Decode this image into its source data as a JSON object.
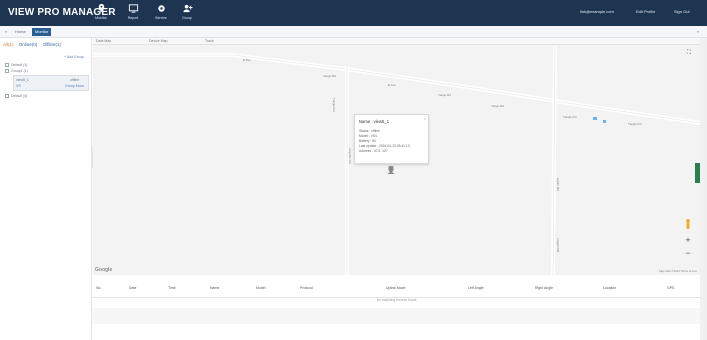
{
  "app": {
    "title": "VIEW PRO MANAGER"
  },
  "nav": [
    {
      "label": "Monitor",
      "icon": "location-pin-icon"
    },
    {
      "label": "Report",
      "icon": "monitor-icon"
    },
    {
      "label": "Service",
      "icon": "gear-icon"
    },
    {
      "label": "Group",
      "icon": "user-add-icon"
    }
  ],
  "topright": {
    "email": "link@example.com",
    "profile": "Edit Profile",
    "signout": "Sign Out"
  },
  "tabs": [
    {
      "label": "Home"
    },
    {
      "label": "Monitor"
    }
  ],
  "sidebar": {
    "filters": [
      "All(1)",
      "Online(0)",
      "Offline(1)"
    ],
    "add_group": "+ Add Group",
    "tree": [
      {
        "label": "Default (1)"
      },
      {
        "label": "Group1 (1)"
      },
      {
        "label": "view5_1",
        "status": "offline"
      },
      {
        "label": "VS",
        "status": "Group Move"
      },
      {
        "label": "Default (0)"
      }
    ]
  },
  "map": {
    "toolbar": [
      "Data Map",
      "Device Map",
      "Track"
    ],
    "roads": [
      "E Ave",
      "Yanjie Rd",
      "E Ave",
      "Yanjie Rd",
      "Yanjie Rd",
      "Tianjie Rd",
      "Tianjie Rd",
      "Tianjie Rd",
      "Ling Shi Rd",
      "Hanfu Rd",
      "Lingshi Rd"
    ],
    "google": "Google",
    "attribution": "Map data ©2024  Terms of Use"
  },
  "popup": {
    "title": "Name : view5_1",
    "rows": [
      "Status : offline",
      "Model : VS4",
      "Battery : 80",
      "Last update : 2024-04-13 05:41:13",
      "Address : 37.5, 127"
    ]
  },
  "table": {
    "headers": [
      "No.",
      "Date",
      "Time",
      "Name",
      "Model",
      "Protocol",
      "Uplink Mode",
      "Left Angle",
      "Right Angle",
      "Location",
      "GPS"
    ],
    "empty": "No matching records found"
  }
}
